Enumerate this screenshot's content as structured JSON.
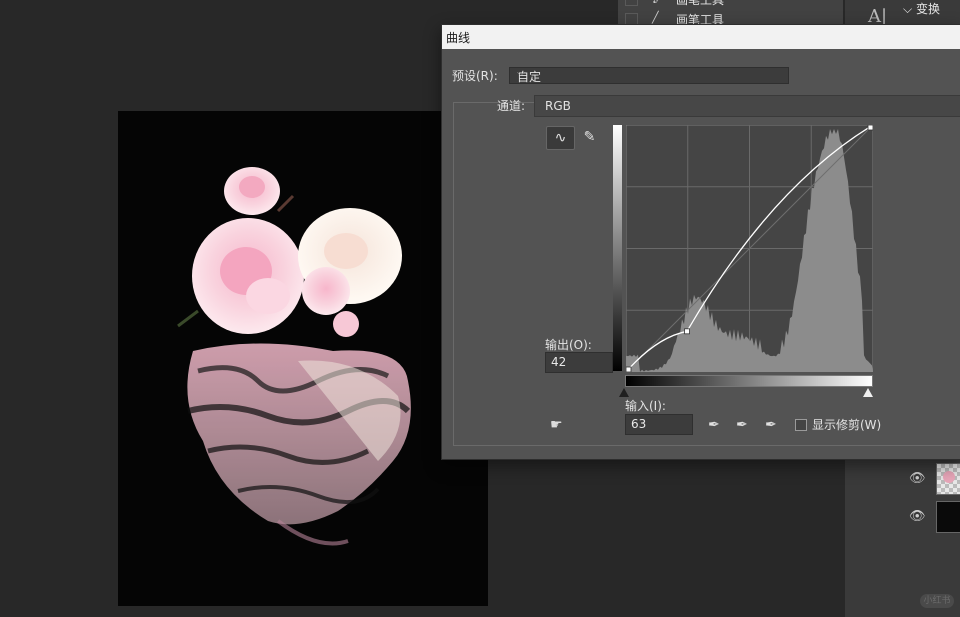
{
  "dialog": {
    "title": "曲线",
    "preset_label": "预设(R):",
    "preset_value": "自定",
    "channel_label": "通道:",
    "channel_value": "RGB",
    "output_label": "输出(O):",
    "output_value": "42",
    "input_label": "输入(I):",
    "input_value": "63",
    "show_clipping_label": "显示修剪(W)",
    "show_clipping_checked": false,
    "curve_points": [
      [
        0,
        0
      ],
      [
        63,
        42
      ],
      [
        255,
        255
      ]
    ]
  },
  "tools_panel": {
    "rows": [
      {
        "label": "画笔工具",
        "icon": "brush-icon"
      },
      {
        "label": "画笔工具",
        "icon": "brush-icon"
      }
    ]
  },
  "properties": {
    "header": "变换"
  },
  "layers": [
    {
      "thumb": "flower-thumbnail"
    },
    {
      "thumb": "black-thumbnail"
    }
  ],
  "colors": {
    "dialog_bg": "#535353",
    "canvas_bg": "#050505",
    "curve_line": "#ffffff",
    "histogram": "#8c8c8c"
  }
}
